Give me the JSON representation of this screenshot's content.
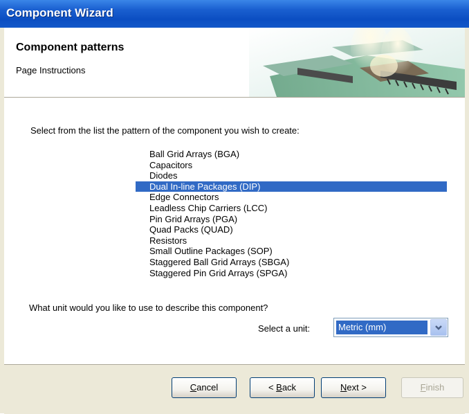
{
  "window": {
    "title": "Component Wizard"
  },
  "header": {
    "title": "Component patterns",
    "subtitle": "Page Instructions"
  },
  "main": {
    "prompt": "Select from the list the pattern of the component you wish to create:",
    "patterns": [
      "Ball Grid Arrays (BGA)",
      "Capacitors",
      "Diodes",
      "Dual In-line Packages (DIP)",
      "Edge Connectors",
      "Leadless Chip Carriers (LCC)",
      "Pin Grid Arrays (PGA)",
      "Quad Packs (QUAD)",
      "Resistors",
      "Small Outline Packages (SOP)",
      "Staggered Ball Grid Arrays (SBGA)",
      "Staggered Pin Grid Arrays (SPGA)"
    ],
    "selected_pattern": "Dual In-line Packages (DIP)",
    "unit_question": "What unit would you like to use to describe this component?",
    "unit_label": "Select a unit:",
    "unit_value": "Metric (mm)"
  },
  "footer": {
    "cancel": {
      "first": "C",
      "rest": "ancel"
    },
    "back": {
      "prefix": "< ",
      "first": "B",
      "rest": "ack"
    },
    "next": {
      "first": "N",
      "rest": "ext >"
    },
    "finish": {
      "first": "F",
      "rest": "inish"
    }
  },
  "colors": {
    "titlebar": "#0b4ec2",
    "selection": "#316ac5",
    "dialog_bg": "#ece9d8"
  },
  "icons": {
    "unit_dropdown": "chevron-down-icon",
    "banner": "pcb-banner-image"
  }
}
